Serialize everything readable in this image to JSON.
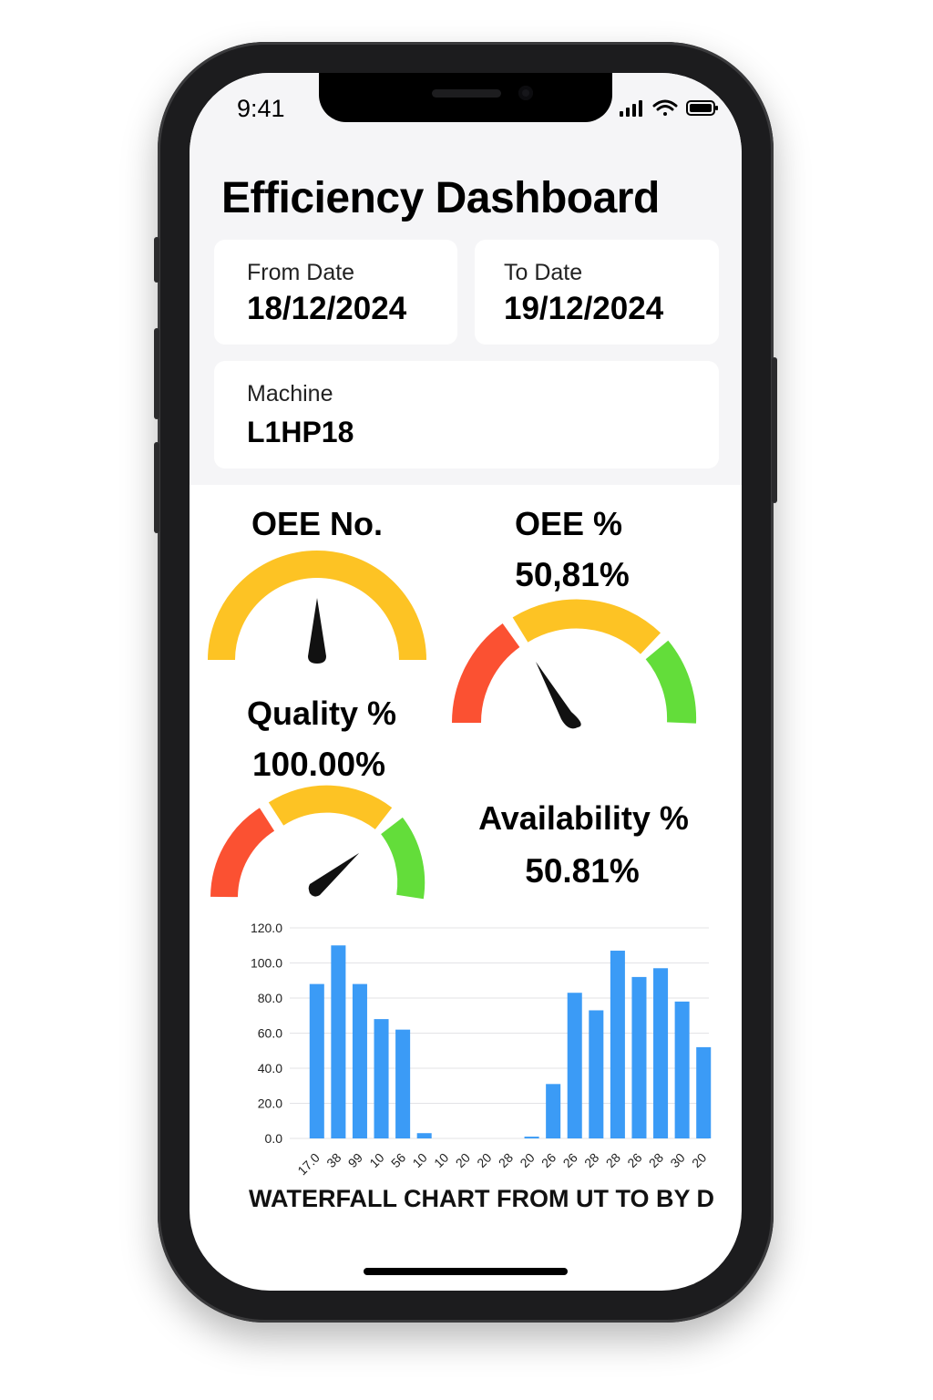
{
  "status_bar": {
    "time": "9:41",
    "icons": [
      "signal-icon",
      "wifi-icon",
      "battery-icon"
    ]
  },
  "header": {
    "title": "Efficiency Dashboard"
  },
  "filters": {
    "from_date": {
      "label": "From Date",
      "value": "18/12/2024"
    },
    "to_date": {
      "label": "To Date",
      "value": "19/12/2024"
    },
    "machine": {
      "label": "Machine",
      "value": "L1HP18"
    }
  },
  "gauges": {
    "oee_no": {
      "title": "OEE No.",
      "level": 0.5,
      "color": "#fdc324"
    },
    "oee_pct": {
      "title": "OEE %",
      "value": "50,81%",
      "level": 0.29
    },
    "quality": {
      "title": "Quality %",
      "value": "100.00%",
      "level": 0.74
    },
    "availability": {
      "title": "Availability %",
      "value": "50.81%"
    },
    "colors": {
      "red": "#fb5132",
      "yellow": "#fdc324",
      "green": "#63dd3a",
      "needle": "#111111"
    }
  },
  "chart_caption": "WATERFALL CHART FROM UT TO BY D",
  "chart_data": {
    "type": "bar",
    "color": "#3b9bf6",
    "ylim": [
      0,
      120
    ],
    "yticks": [
      "0.0",
      "20.0",
      "40.0",
      "60.0",
      "80.0",
      "100.0",
      "120.0"
    ],
    "grid": true,
    "categories": [
      "17.0",
      "38",
      "99",
      "10",
      "56",
      "10",
      "10",
      "20",
      "20",
      "28",
      "20",
      "26",
      "26",
      "28",
      "28",
      "26",
      "28",
      "30",
      "20"
    ],
    "values": [
      88,
      110,
      88,
      68,
      62,
      3,
      0,
      0,
      0,
      0,
      1,
      31,
      83,
      73,
      107,
      92,
      97,
      78,
      52
    ],
    "xlabel": "",
    "ylabel": ""
  }
}
